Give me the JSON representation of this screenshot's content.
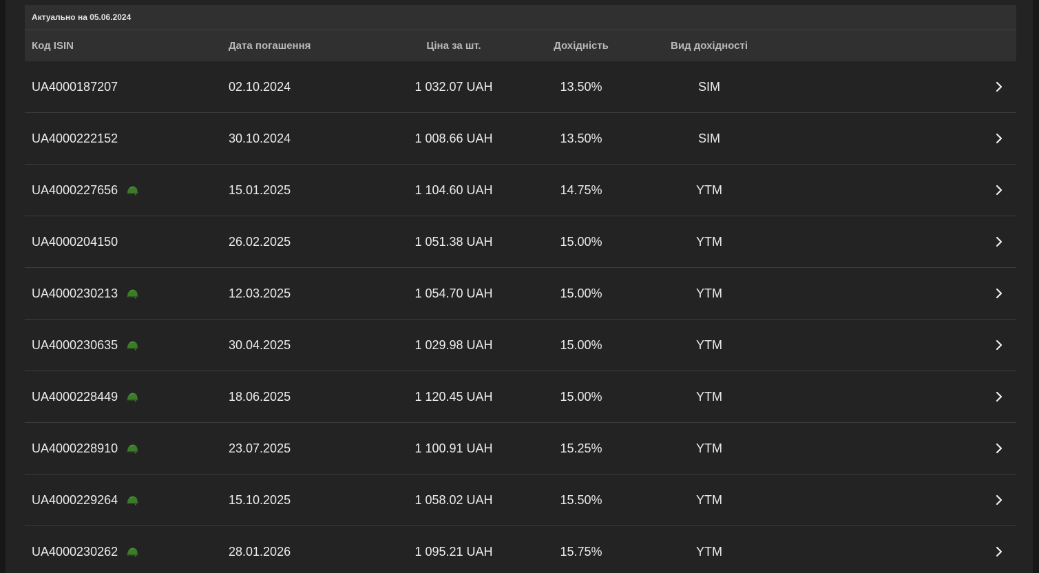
{
  "table": {
    "actual_label": "Актуально на 05.06.2024",
    "headers": {
      "isin": "Код ISIN",
      "date": "Дата погашення",
      "price": "Ціна за шт.",
      "yield": "Дохідність",
      "yield_type": "Вид дохідності"
    },
    "colors": {
      "helmet": "#3d7a2a",
      "background": "#232323",
      "header_bg": "#303030"
    },
    "rows": [
      {
        "isin": "UA4000187207",
        "military": false,
        "date": "02.10.2024",
        "price": "1 032.07 UAH",
        "yield": "13.50%",
        "yield_type": "SIM"
      },
      {
        "isin": "UA4000222152",
        "military": false,
        "date": "30.10.2024",
        "price": "1 008.66 UAH",
        "yield": "13.50%",
        "yield_type": "SIM"
      },
      {
        "isin": "UA4000227656",
        "military": true,
        "date": "15.01.2025",
        "price": "1 104.60 UAH",
        "yield": "14.75%",
        "yield_type": "YTM"
      },
      {
        "isin": "UA4000204150",
        "military": false,
        "date": "26.02.2025",
        "price": "1 051.38 UAH",
        "yield": "15.00%",
        "yield_type": "YTM"
      },
      {
        "isin": "UA4000230213",
        "military": true,
        "date": "12.03.2025",
        "price": "1 054.70 UAH",
        "yield": "15.00%",
        "yield_type": "YTM"
      },
      {
        "isin": "UA4000230635",
        "military": true,
        "date": "30.04.2025",
        "price": "1 029.98 UAH",
        "yield": "15.00%",
        "yield_type": "YTM"
      },
      {
        "isin": "UA4000228449",
        "military": true,
        "date": "18.06.2025",
        "price": "1 120.45 UAH",
        "yield": "15.00%",
        "yield_type": "YTM"
      },
      {
        "isin": "UA4000228910",
        "military": true,
        "date": "23.07.2025",
        "price": "1 100.91 UAH",
        "yield": "15.25%",
        "yield_type": "YTM"
      },
      {
        "isin": "UA4000229264",
        "military": true,
        "date": "15.10.2025",
        "price": "1 058.02 UAH",
        "yield": "15.50%",
        "yield_type": "YTM"
      },
      {
        "isin": "UA4000230262",
        "military": true,
        "date": "28.01.2026",
        "price": "1 095.21 UAH",
        "yield": "15.75%",
        "yield_type": "YTM"
      }
    ]
  }
}
